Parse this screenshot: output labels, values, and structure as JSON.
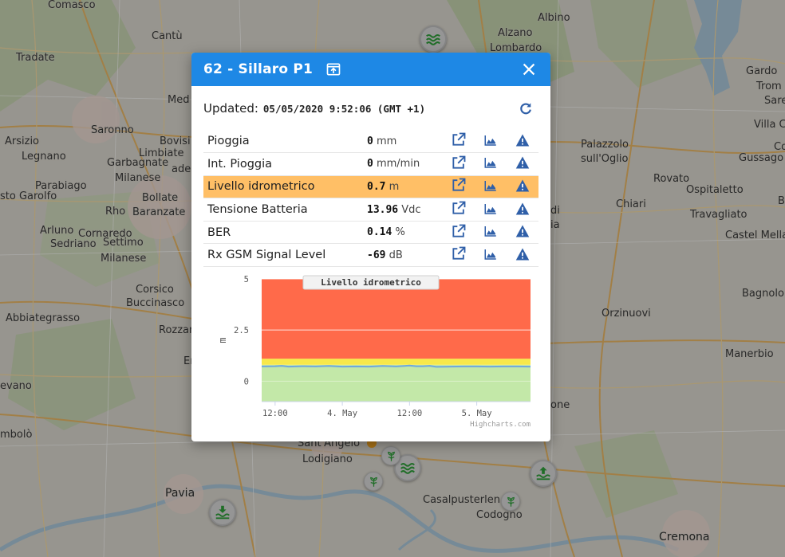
{
  "dialog": {
    "title": "62 - Sillaro P1",
    "updated_label": "Updated:",
    "updated_value": "05/05/2020 9:52:06 (GMT +1)",
    "icons": {
      "pin": "open-in-window-icon",
      "close": "close-icon",
      "refresh": "refresh-icon"
    }
  },
  "sensors": [
    {
      "name": "Pioggia",
      "value": "0",
      "unit": "mm",
      "highlight": false
    },
    {
      "name": "Int. Pioggia",
      "value": "0",
      "unit": "mm/min",
      "highlight": false
    },
    {
      "name": "Livello idrometrico",
      "value": "0.7",
      "unit": "m",
      "highlight": true
    },
    {
      "name": "Tensione Batteria",
      "value": "13.96",
      "unit": "Vdc",
      "highlight": false
    },
    {
      "name": "BER",
      "value": "0.14",
      "unit": "%",
      "highlight": false
    },
    {
      "name": "Rx GSM Signal Level",
      "value": "-69",
      "unit": "dB",
      "highlight": false
    }
  ],
  "row_icons": [
    "open-external-icon",
    "area-chart-icon",
    "warning-icon"
  ],
  "colors": {
    "header": "#1e88e5",
    "highlight": "#ffbf66",
    "icon": "#2f5fa8",
    "band_red": "#ff6a4a",
    "band_yellow": "#f7e84a",
    "band_green": "#c3e8a8",
    "line": "#6fa8dc"
  },
  "chart_data": {
    "type": "area",
    "title": "Livello idrometrico",
    "ylabel": "m",
    "ylim": [
      -1,
      5
    ],
    "yticks": [
      "5",
      "2.5",
      "0"
    ],
    "ytick_values": [
      5,
      2.5,
      0
    ],
    "xticks": [
      "12:00",
      "4. May",
      "12:00",
      "5. May"
    ],
    "xtick_values": [
      0.5,
      1.0,
      1.5,
      2.0
    ],
    "x_range": [
      0.4,
      2.4
    ],
    "bands": [
      {
        "from": -1,
        "to": 0.8,
        "color": "#c3e8a8"
      },
      {
        "from": 0.8,
        "to": 1.1,
        "color": "#f7e84a"
      },
      {
        "from": 1.1,
        "to": 5,
        "color": "#ff6a4a"
      }
    ],
    "series": [
      {
        "values": [
          [
            0.4,
            0.72
          ],
          [
            0.5,
            0.73
          ],
          [
            0.55,
            0.75
          ],
          [
            0.6,
            0.71
          ],
          [
            0.7,
            0.73
          ],
          [
            0.8,
            0.72
          ],
          [
            0.9,
            0.74
          ],
          [
            1.0,
            0.71
          ],
          [
            1.1,
            0.72
          ],
          [
            1.2,
            0.71
          ],
          [
            1.3,
            0.74
          ],
          [
            1.4,
            0.72
          ],
          [
            1.5,
            0.76
          ],
          [
            1.55,
            0.73
          ],
          [
            1.6,
            0.73
          ],
          [
            1.65,
            0.75
          ],
          [
            1.7,
            0.7
          ],
          [
            1.8,
            0.71
          ],
          [
            1.9,
            0.72
          ],
          [
            2.0,
            0.72
          ],
          [
            2.1,
            0.71
          ],
          [
            2.2,
            0.72
          ],
          [
            2.3,
            0.72
          ],
          [
            2.4,
            0.71
          ]
        ]
      }
    ],
    "credits": "Highcharts.com"
  },
  "map": {
    "places": [
      {
        "name": "Comasco",
        "big": false
      },
      {
        "name": "Albino",
        "big": false
      },
      {
        "name": "Cantù",
        "big": false
      },
      {
        "name": "Alzano",
        "big": false
      },
      {
        "name": "Lombardo",
        "big": false
      },
      {
        "name": "Tradate",
        "big": false
      },
      {
        "name": "Gardo",
        "big": false
      },
      {
        "name": "Trom",
        "big": false
      },
      {
        "name": "Sare",
        "big": false
      },
      {
        "name": "Med",
        "big": false
      },
      {
        "name": "Villa C",
        "big": false
      },
      {
        "name": "Saronno",
        "big": false
      },
      {
        "name": "Arsizio",
        "big": false
      },
      {
        "name": "Bovisi",
        "big": false
      },
      {
        "name": "Legnano",
        "big": false
      },
      {
        "name": "Limbiate",
        "big": false
      },
      {
        "name": "Garbagnate",
        "big": false
      },
      {
        "name": "Palazzolo",
        "big": false
      },
      {
        "name": "sull'Oglio",
        "big": false
      },
      {
        "name": "Co",
        "big": false
      },
      {
        "name": "Gussago",
        "big": false
      },
      {
        "name": "ade",
        "big": false
      },
      {
        "name": "Milanese",
        "big": false
      },
      {
        "name": "Parabiago",
        "big": false
      },
      {
        "name": "Rovato",
        "big": false
      },
      {
        "name": "sto Garolfo",
        "big": false
      },
      {
        "name": "Bollate",
        "big": false
      },
      {
        "name": "Ospitaletto",
        "big": false
      },
      {
        "name": "Rho",
        "big": false
      },
      {
        "name": "Baranzate",
        "big": false
      },
      {
        "name": "Chiari",
        "big": false
      },
      {
        "name": "di",
        "big": false
      },
      {
        "name": "Travagliato",
        "big": false
      },
      {
        "name": "B",
        "big": false
      },
      {
        "name": "Arluno",
        "big": false
      },
      {
        "name": "Cornaredo",
        "big": false
      },
      {
        "name": "Sedriano",
        "big": false
      },
      {
        "name": "Settimo",
        "big": false
      },
      {
        "name": "Castel Mella",
        "big": false
      },
      {
        "name": "Milanese",
        "big": false
      },
      {
        "name": "Corsico",
        "big": false
      },
      {
        "name": "Bagnolo",
        "big": false
      },
      {
        "name": "Buccinasco",
        "big": false
      },
      {
        "name": "Orzinuovi",
        "big": false
      },
      {
        "name": "Abbiategrasso",
        "big": false
      },
      {
        "name": "Rozzan",
        "big": false
      },
      {
        "name": "Manerbio",
        "big": false
      },
      {
        "name": "Er",
        "big": false
      },
      {
        "name": "evano",
        "big": false
      },
      {
        "name": "one",
        "big": false
      },
      {
        "name": "mbolò",
        "big": false
      },
      {
        "name": "Sant'Angelo",
        "big": false
      },
      {
        "name": "Lodigiano",
        "big": false
      },
      {
        "name": "Pavia",
        "big": true
      },
      {
        "name": "Casalpusterlen",
        "big": false
      },
      {
        "name": "Codogno",
        "big": false
      },
      {
        "name": "Cremona",
        "big": true
      },
      {
        "name": "ia",
        "big": false
      }
    ]
  }
}
